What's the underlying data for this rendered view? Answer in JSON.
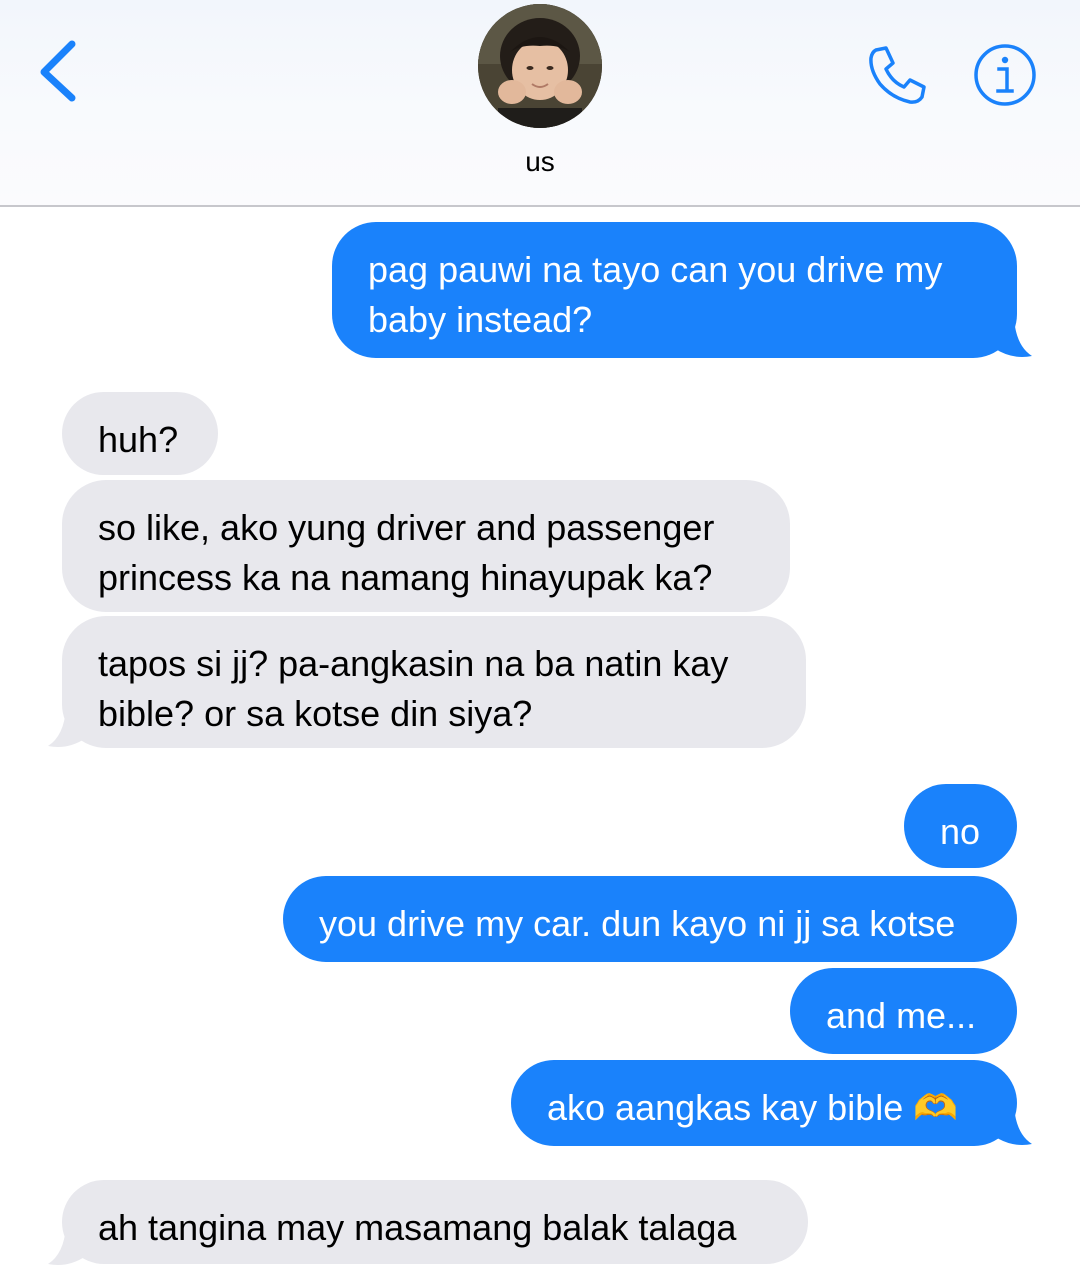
{
  "header": {
    "contact_name": "us",
    "back_icon": "chevron-left-icon",
    "call_icon": "phone-icon",
    "info_icon": "info-icon"
  },
  "colors": {
    "accent": "#1a82fb",
    "sent_bubble": "#1a82fb",
    "received_bubble": "#e8e8ed"
  },
  "messages": [
    {
      "direction": "sent",
      "text": "pag pauwi na tayo can you drive my baby instead?"
    },
    {
      "direction": "received",
      "text": "huh?"
    },
    {
      "direction": "received",
      "text": "so like, ako yung driver and passenger princess ka na namang hinayupak ka?"
    },
    {
      "direction": "received",
      "text": "tapos si jj? pa-angkasin na ba natin kay bible? or sa kotse din siya?"
    },
    {
      "direction": "sent",
      "text": "no"
    },
    {
      "direction": "sent",
      "text": "you drive my car. dun kayo ni jj sa kotse"
    },
    {
      "direction": "sent",
      "text": "and me..."
    },
    {
      "direction": "sent",
      "text": "ako aangkas kay bible 🫶"
    },
    {
      "direction": "received",
      "text": "ah tangina may masamang balak talaga"
    }
  ]
}
